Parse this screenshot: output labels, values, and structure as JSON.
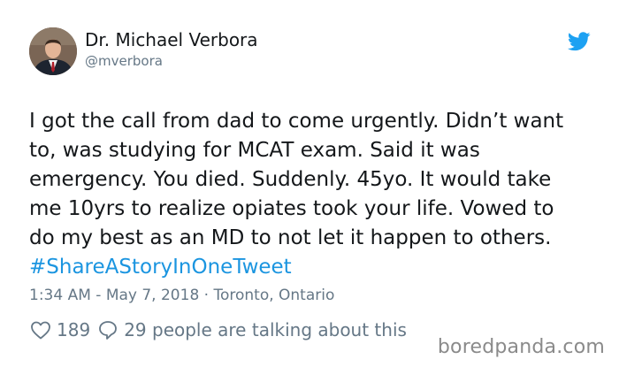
{
  "author": {
    "display_name": "Dr. Michael Verbora",
    "handle": "@mverbora"
  },
  "tweet": {
    "lines": [
      "I got the call from dad to come urgently. Didn’t want",
      "to, was studying for MCAT exam. Said it was",
      "emergency. You died. Suddenly. 45yo. It would take",
      "me 10yrs to realize opiates took your life. Vowed to",
      "do my best as an MD to not let it happen to others."
    ],
    "hashtag": "#ShareAStoryInOneTweet"
  },
  "meta": {
    "timestamp": "1:34 AM - May 7, 2018 · Toronto, Ontario"
  },
  "actions": {
    "likes": "189",
    "replies_text": "29 people are talking about this"
  },
  "watermark": "boredpanda.com",
  "icons": {
    "brand": "twitter-bird-icon",
    "like": "heart-icon",
    "reply": "speech-bubble-icon"
  },
  "colors": {
    "text": "#14171a",
    "muted": "#657786",
    "link": "#1b95e0",
    "twitter_blue": "#1da1f2"
  }
}
